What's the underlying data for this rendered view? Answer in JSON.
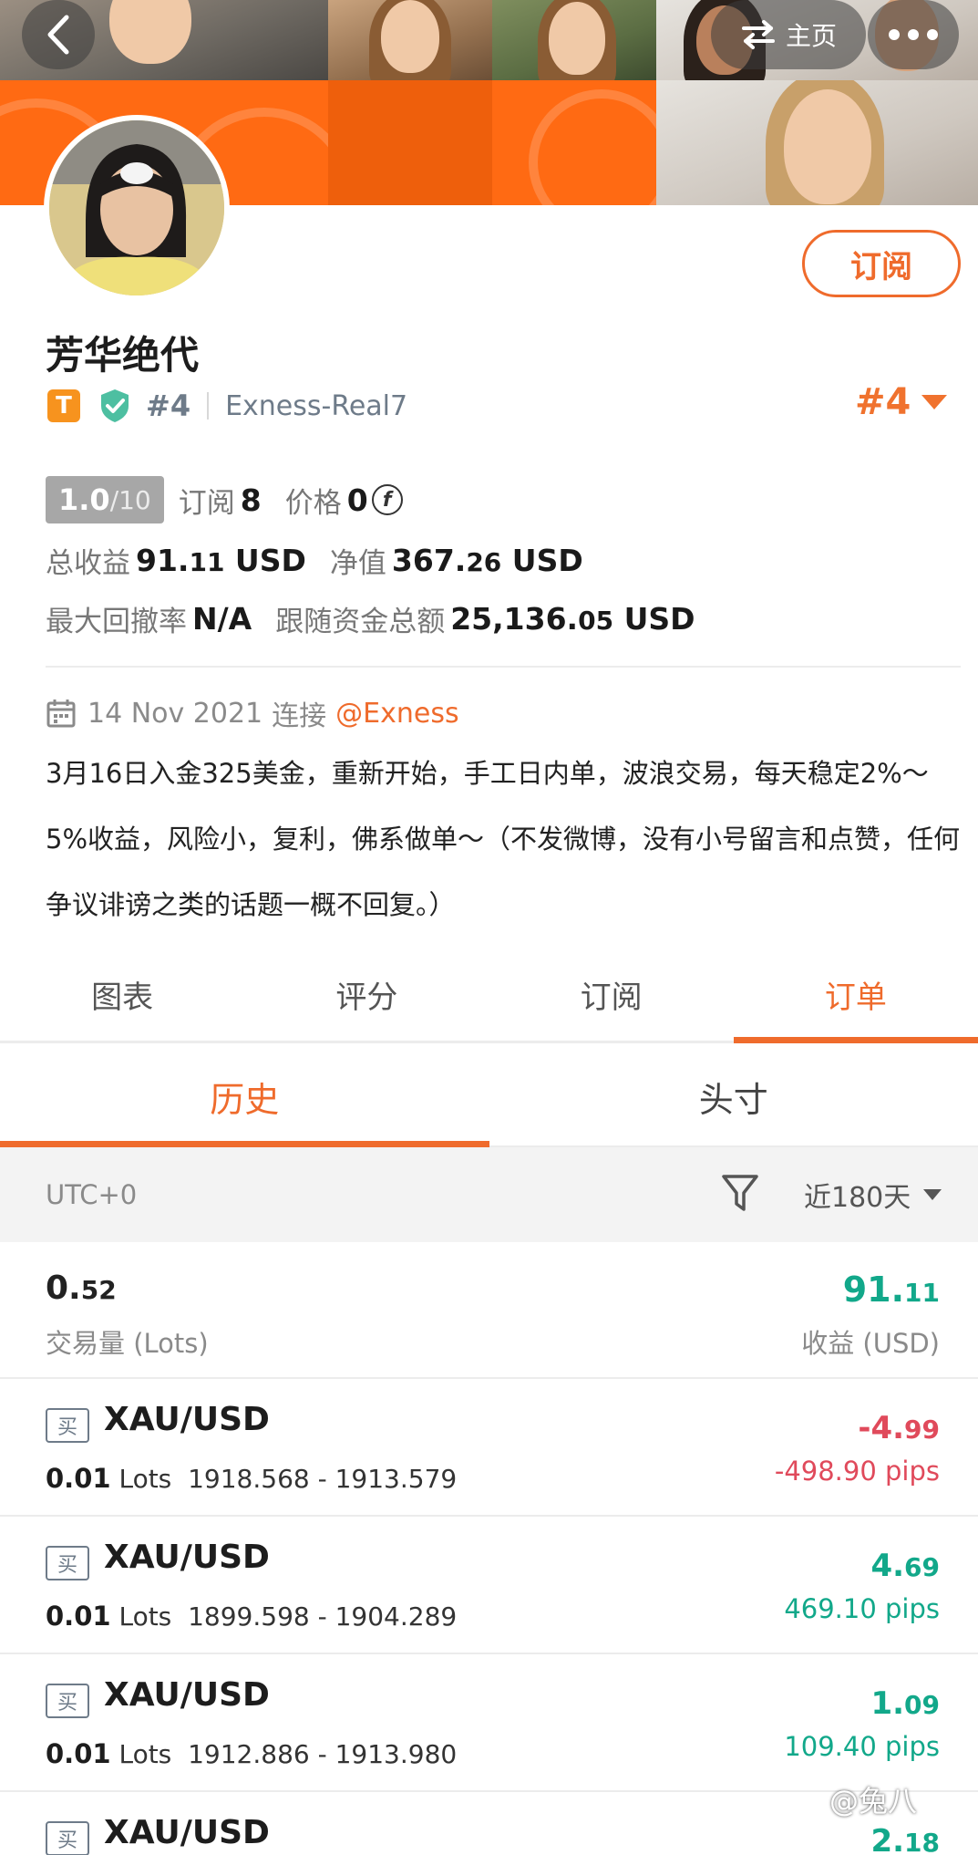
{
  "header": {
    "home_label": "主页"
  },
  "profile": {
    "name": "芳华绝代",
    "badge_letter": "T",
    "rank_small": "#4",
    "server": "Exness-Real7",
    "rank_big": "#4",
    "subscribe_label": "订阅"
  },
  "stats": {
    "score": "1.0",
    "score_max": "/10",
    "subscribe_label": "订阅",
    "subscribe_count": "8",
    "price_label": "价格",
    "price_value": "0",
    "total_profit_label": "总收益",
    "total_profit_int": "91.",
    "total_profit_dec": "11",
    "total_profit_unit": " USD",
    "equity_label": "净值",
    "equity_int": "367.",
    "equity_dec": "26",
    "equity_unit": " USD",
    "max_drawdown_label": "最大回撤率",
    "max_drawdown_value": "N/A",
    "follow_funds_label": "跟随资金总额",
    "follow_funds_int": "25,136.",
    "follow_funds_dec": "05",
    "follow_funds_unit": " USD"
  },
  "join": {
    "date": "14 Nov 2021",
    "connect_label": "连接",
    "broker": "@Exness"
  },
  "bio": "3月16日入金325美金，重新开始，手工日内单，波浪交易，每天稳定2%～5%收益，风险小，复利，佛系做单～（不发微博，没有小号留言和点赞，任何争议诽谤之类的话题一概不回复。）",
  "tabs": [
    "图表",
    "评分",
    "订阅",
    "订单"
  ],
  "active_tab": 3,
  "subtabs": [
    "历史",
    "头寸"
  ],
  "filter": {
    "timezone": "UTC+0",
    "period": "近180天"
  },
  "summary": {
    "volume_int": "0.",
    "volume_dec": "52",
    "volume_label": "交易量 (Lots)",
    "profit_int": "91.",
    "profit_dec": "11",
    "profit_label": "收益 (USD)"
  },
  "orders": [
    {
      "side": "买",
      "symbol": "XAU/USD",
      "lots": "0.01",
      "lots_unit": "Lots",
      "prices": "1918.568 - 1913.579",
      "profit_int": "-4.",
      "profit_dec": "99",
      "pips": "-498.90 pips",
      "sign": "neg"
    },
    {
      "side": "买",
      "symbol": "XAU/USD",
      "lots": "0.01",
      "lots_unit": "Lots",
      "prices": "1899.598 - 1904.289",
      "profit_int": "4.",
      "profit_dec": "69",
      "pips": "469.10 pips",
      "sign": "pos"
    },
    {
      "side": "买",
      "symbol": "XAU/USD",
      "lots": "0.01",
      "lots_unit": "Lots",
      "prices": "1912.886 - 1913.980",
      "profit_int": "1.",
      "profit_dec": "09",
      "pips": "109.40 pips",
      "sign": "pos"
    },
    {
      "side": "买",
      "symbol": "XAU/USD",
      "lots": "",
      "lots_unit": "",
      "prices": "",
      "profit_int": "2.",
      "profit_dec": "18",
      "pips": "",
      "sign": "pos"
    }
  ],
  "watermark": "@兔八",
  "colors": {
    "accent": "#ef6b2c",
    "banner_orange": "#ff6a13",
    "positive": "#12a88a",
    "negative": "#e04a5b"
  },
  "icons": {
    "back": "chevron-left-icon",
    "home": "swap-icon",
    "more": "more-dots-icon",
    "verified": "shield-check-icon",
    "calendar": "calendar-icon",
    "filter": "filter-funnel-icon",
    "dropdown": "caret-down-icon"
  }
}
